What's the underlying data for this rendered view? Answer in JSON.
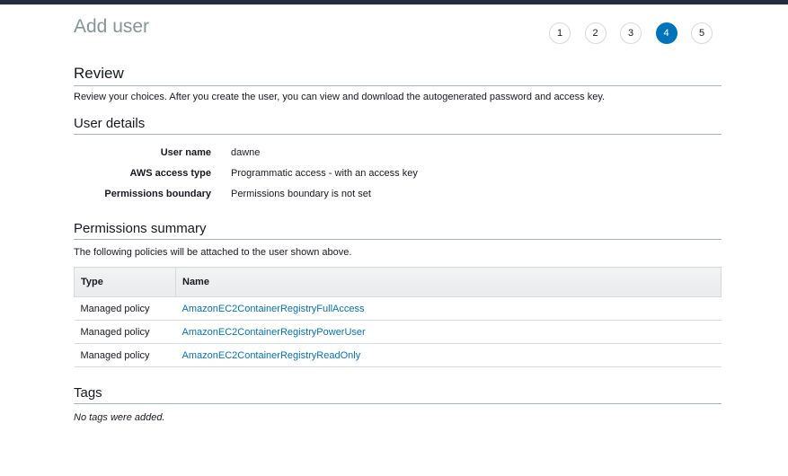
{
  "header": {
    "title": "Add user",
    "steps": [
      {
        "label": "1",
        "active": false
      },
      {
        "label": "2",
        "active": false
      },
      {
        "label": "3",
        "active": false
      },
      {
        "label": "4",
        "active": true
      },
      {
        "label": "5",
        "active": false
      }
    ]
  },
  "review": {
    "title": "Review",
    "description": "Review your choices. After you create the user, you can view and download the autogenerated password and access key."
  },
  "user_details": {
    "title": "User details",
    "rows": [
      {
        "label": "User name",
        "value": "dawne"
      },
      {
        "label": "AWS access type",
        "value": "Programmatic access - with an access key"
      },
      {
        "label": "Permissions boundary",
        "value": "Permissions boundary is not set"
      }
    ]
  },
  "permissions": {
    "title": "Permissions summary",
    "description": "The following policies will be attached to the user shown above.",
    "columns": [
      "Type",
      "Name"
    ],
    "rows": [
      {
        "type": "Managed policy",
        "name": "AmazonEC2ContainerRegistryFullAccess"
      },
      {
        "type": "Managed policy",
        "name": "AmazonEC2ContainerRegistryPowerUser"
      },
      {
        "type": "Managed policy",
        "name": "AmazonEC2ContainerRegistryReadOnly"
      }
    ]
  },
  "tags": {
    "title": "Tags",
    "empty_text": "No tags were added."
  },
  "colors": {
    "accent": "#0073bb",
    "top_bar": "#232f3e"
  }
}
